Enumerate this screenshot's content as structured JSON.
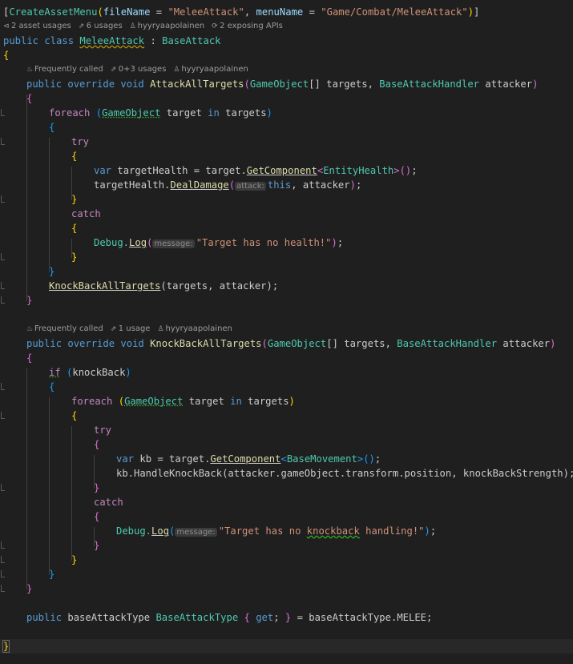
{
  "lens": {
    "class": {
      "usages": "2 asset usages",
      "refs": "6 usages",
      "author": "hyyryaapolainen",
      "apis": "2 exposing APIs"
    },
    "attack_method": {
      "freq": "Frequently called",
      "usages": "0+3 usages",
      "author": "hyyryaapolainen"
    },
    "knock_method": {
      "freq": "Frequently called",
      "usages": "1 usage",
      "author": "hyyryaapolainen"
    }
  },
  "hints": {
    "attack": "attack:",
    "message1": "message:",
    "message2": "message:"
  },
  "code": {
    "attr_name": "CreateAssetMenu",
    "attr_file_key": "fileName",
    "attr_file_val": "\"MeleeAttack\"",
    "attr_menu_key": "menuName",
    "attr_menu_val": "\"Game/Combat/MeleeAttack\"",
    "class_kw": "public class ",
    "class_name": "MeleeAttack",
    "base_class": "BaseAttack",
    "m1_kw": "public override void ",
    "m1_name": "AttackAllTargets",
    "go_type": "GameObject",
    "targets": " targets, ",
    "handler_type": "BaseAttackHandler",
    "attacker": " attacker",
    "foreach": "foreach",
    "target_in": " target ",
    "in": "in",
    "targets2": " targets",
    "try": "try",
    "var": "var",
    "health_decl": " targetHealth = target.",
    "get_component": "GetComponent",
    "entity_health": "EntityHealth",
    "target_health": "targetHealth.",
    "deal_damage": "DealDamage",
    "this": "this",
    "comma_attacker": ", attacker",
    "catch": "catch",
    "debug": "Debug.",
    "log": "Log",
    "msg1": "\"Target has no health!\"",
    "knock_call": "KnockBackAllTargets",
    "knock_call_args": "(targets, attacker);",
    "m2_kw": "public override void ",
    "m2_name": "KnockBackAllTargets",
    "if": "if",
    "knockback_var": "knockBack",
    "kb_decl": " kb = target.",
    "base_movement": "BaseMovement",
    "handle_knock": "kb.HandleKnockBack(attacker.gameObject.transform.position, knockBackStrength);",
    "msg2_a": "\"Target has no ",
    "msg2_b": "knockback",
    "msg2_c": " handling!\"",
    "prop_kw": "public ",
    "prop_type": "baseAttackType",
    "prop_rest1": " BaseAttackType ",
    "get": "get",
    "prop_rest2": " = baseAttackType.MELEE;"
  }
}
